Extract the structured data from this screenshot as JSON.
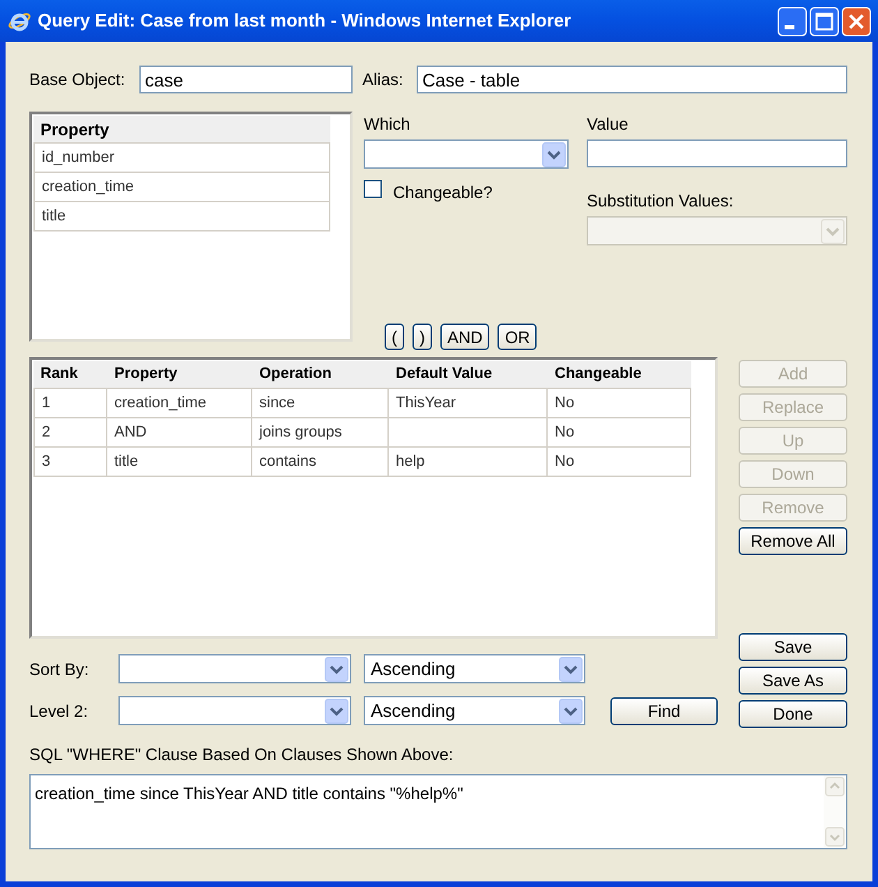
{
  "window": {
    "title": "Query Edit: Case from last month - Windows Internet Explorer"
  },
  "base_object": {
    "label": "Base Object:",
    "value": "case"
  },
  "alias": {
    "label": "Alias:",
    "value": "Case - table"
  },
  "property_list": {
    "header": "Property",
    "items": [
      "id_number",
      "creation_time",
      "title"
    ]
  },
  "which": {
    "label": "Which"
  },
  "value": {
    "label": "Value"
  },
  "changeable": {
    "label": "Changeable?",
    "checked": false
  },
  "substitution": {
    "label": "Substitution Values:",
    "disabled": true
  },
  "group_buttons": [
    "(",
    ")",
    "AND",
    "OR"
  ],
  "clauses": {
    "columns": [
      "Rank",
      "Property",
      "Operation",
      "Default Value",
      "Changeable"
    ],
    "rows": [
      {
        "rank": "1",
        "property": "creation_time",
        "operation": "since",
        "default_value": "ThisYear",
        "changeable": "No"
      },
      {
        "rank": "2",
        "property": "AND",
        "operation": "joins groups",
        "changeable": "No"
      },
      {
        "rank": "3",
        "property": "title",
        "operation": "contains",
        "default_value": "help",
        "changeable": "No"
      }
    ]
  },
  "side_buttons": [
    {
      "label": "Add",
      "disabled": true
    },
    {
      "label": "Replace",
      "disabled": true
    },
    {
      "label": "Up",
      "disabled": true
    },
    {
      "label": "Down",
      "disabled": true
    },
    {
      "label": "Remove",
      "disabled": true
    },
    {
      "label": "Remove All",
      "disabled": false
    }
  ],
  "sort_by": {
    "label": "Sort By:",
    "order": "Ascending"
  },
  "level_2": {
    "label": "Level 2:",
    "order": "Ascending"
  },
  "find_button": "Find",
  "action_buttons": [
    "Save",
    "Save As",
    "Done"
  ],
  "sql": {
    "label": "SQL \"WHERE\" Clause Based On Clauses Shown Above:",
    "value": "creation_time since ThisYear AND title contains \"%help%\""
  }
}
